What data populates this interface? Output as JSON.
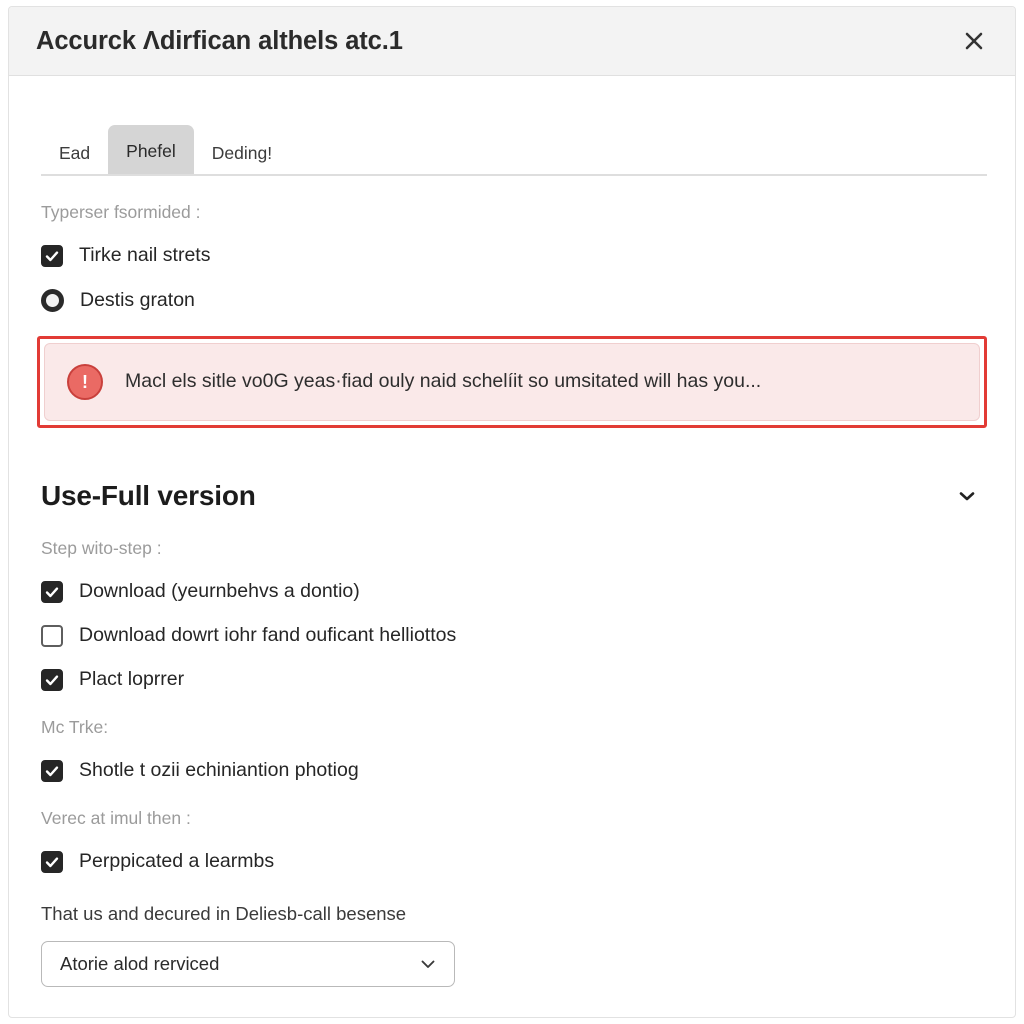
{
  "dialog": {
    "title": "Accurck Λdirfican althels atc.1",
    "close_icon": "close-icon"
  },
  "tabs": [
    {
      "label": "Ead",
      "active": false
    },
    {
      "label": "Phefel",
      "active": true
    },
    {
      "label": "Deding!",
      "active": false
    }
  ],
  "form": {
    "group_label": "Typerser fsormided :",
    "checkbox": {
      "label": "Tirke nail strets",
      "checked": true
    },
    "radio": {
      "label": "Destis graton",
      "selected": true
    }
  },
  "alert": {
    "icon": "error-exclamation-icon",
    "text": "Macl els sitle vo0G yeas·fiad ouly naid schelíit so umsitated will has you...",
    "border_color": "#e23b35",
    "background_color": "#fae9e9"
  },
  "section": {
    "title": "Use-Full version",
    "chevron_icon": "chevron-down-icon",
    "step_label": "Step wito-step :",
    "steps": [
      {
        "label": "Download (yeurnbehvs a dontio)",
        "checked": true
      },
      {
        "label": "Download dowrt iohr fand ouficant helliottos",
        "checked": false
      },
      {
        "label": "Plact loprrer",
        "checked": true
      }
    ],
    "track_label": "Mc Trke:",
    "track_items": [
      {
        "label": "Shotle t ozii echiniantion photiog",
        "checked": true
      }
    ],
    "verify_label": "Verec at imul then :",
    "verify_items": [
      {
        "label": "Perppicated a learmbs",
        "checked": true
      }
    ]
  },
  "select": {
    "label": "That us and decured in Deliesb-call besense",
    "value": "Atorie alod rerviced",
    "caret_icon": "chevron-down-icon"
  }
}
